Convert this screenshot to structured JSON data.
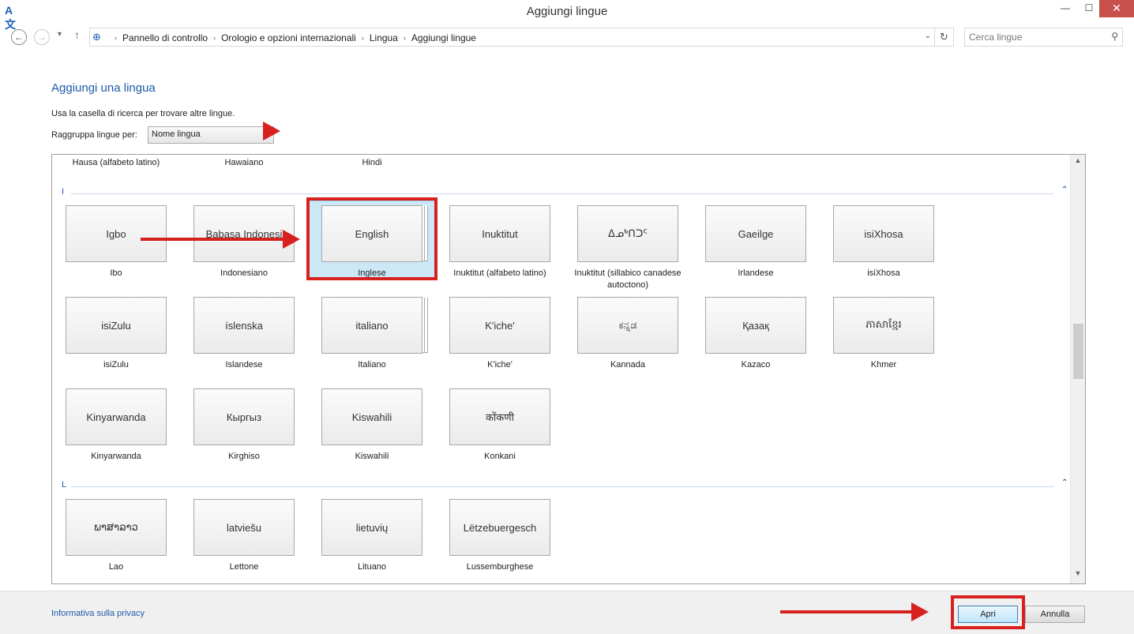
{
  "window": {
    "title": "Aggiungi lingue",
    "min_glyph": "—",
    "max_glyph": "☐",
    "close_glyph": "✕"
  },
  "nav": {
    "back_glyph": "←",
    "forward_glyph": "→",
    "recent_glyph": "▾",
    "up_glyph": "↑",
    "breadcrumbs": [
      "Pannello di controllo",
      "Orologio e opzioni internazionali",
      "Lingua",
      "Aggiungi lingue"
    ],
    "separator": "›",
    "dropdown_glyph": "⌄",
    "refresh_glyph": "↻",
    "search_placeholder": "Cerca lingue",
    "search_glyph": "⚲"
  },
  "main": {
    "heading": "Aggiungi una lingua",
    "subtext": "Usa la casella di ricerca per trovare altre lingue.",
    "group_label": "Raggruppa lingue per:",
    "group_value": "Nome lingua",
    "group_arrow": "▾"
  },
  "list": {
    "previous_captions": [
      "Hausa (alfabeto latino)",
      "Hawaiano",
      "Hindi"
    ],
    "sections": [
      {
        "letter": "I",
        "collapse_glyph": "⌃",
        "items": [
          {
            "native": "Igbo",
            "caption": "Ibo"
          },
          {
            "native": "Babasa Indonesi",
            "caption": "Indonesiano"
          },
          {
            "native": "English",
            "caption": "Inglese"
          },
          {
            "native": "Inuktitut",
            "caption": "Inuktitut (alfabeto latino)"
          },
          {
            "native": "ᐃᓄᒃᑎᑐᑦ",
            "caption": "Inuktitut (sillabico canadese autoctono)"
          },
          {
            "native": "Gaeilge",
            "caption": "Irlandese"
          },
          {
            "native": "isiXhosa",
            "caption": "isiXhosa"
          },
          {
            "native": "isiZulu",
            "caption": "isiZulu"
          },
          {
            "native": "íslenska",
            "caption": "Islandese"
          },
          {
            "native": "italiano",
            "caption": "Italiano"
          },
          {
            "native": "K'iche'",
            "caption": "K'iche'"
          },
          {
            "native": "ಕನ್ನಡ",
            "caption": "Kannada"
          },
          {
            "native": "Қазақ",
            "caption": "Kazaco"
          },
          {
            "native": "ភាសាខ្មែរ",
            "caption": "Khmer"
          },
          {
            "native": "Kinyarwanda",
            "caption": "Kinyarwanda"
          },
          {
            "native": "Кыргыз",
            "caption": "Kirghiso"
          },
          {
            "native": "Kiswahili",
            "caption": "Kiswahili"
          },
          {
            "native": "कोंकणी",
            "caption": "Konkani"
          }
        ]
      },
      {
        "letter": "L",
        "collapse_glyph": "⌃",
        "items": [
          {
            "native": "ພາສາລາວ",
            "caption": "Lao"
          },
          {
            "native": "latviešu",
            "caption": "Lettone"
          },
          {
            "native": "lietuvių",
            "caption": "Lituano"
          },
          {
            "native": "Lëtzebuergesch",
            "caption": "Lussemburghese"
          }
        ]
      }
    ],
    "selected": "English"
  },
  "scrollbar": {
    "up_glyph": "▲",
    "down_glyph": "▼"
  },
  "footer": {
    "privacy_link": "Informativa sulla privacy",
    "open_button": "Apri",
    "cancel_button": "Annulla"
  },
  "annotations": {
    "color": "#d6211f"
  }
}
